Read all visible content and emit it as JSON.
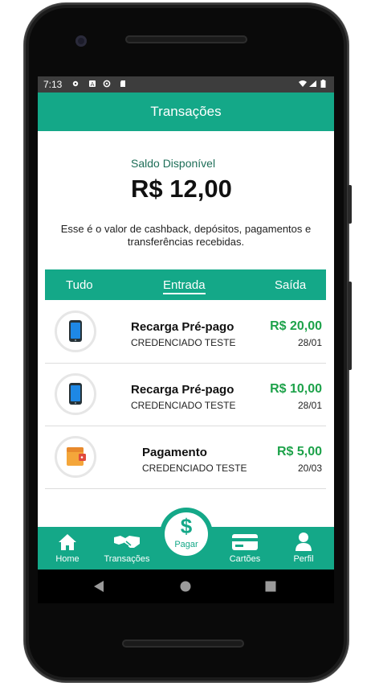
{
  "statusbar": {
    "time": "7:13"
  },
  "appbar": {
    "title": "Transações"
  },
  "balance": {
    "label": "Saldo Disponível",
    "value": "R$ 12,00",
    "description_line1": "Esse é o valor de cashback, depósitos, pagamentos e",
    "description_line2": "transferências recebidas."
  },
  "tabs": [
    {
      "label": "Tudo",
      "active": false
    },
    {
      "label": "Entrada",
      "active": true
    },
    {
      "label": "Saída",
      "active": false
    }
  ],
  "transactions": [
    {
      "title": "Recarga Pré-pago",
      "subtitle": "CREDENCIADO TESTE",
      "amount": "R$ 20,00",
      "date": "28/01",
      "icon": "phone-icon"
    },
    {
      "title": "Recarga Pré-pago",
      "subtitle": "CREDENCIADO TESTE",
      "amount": "R$ 10,00",
      "date": "28/01",
      "icon": "phone-icon"
    },
    {
      "title": "Pagamento",
      "subtitle": "CREDENCIADO TESTE",
      "amount": "R$ 5,00",
      "date": "20/03",
      "icon": "wallet-icon"
    }
  ],
  "bottom_nav": {
    "home": "Home",
    "transactions": "Transações",
    "pay": "Pagar",
    "pay_symbol": "$",
    "cards": "Cartões",
    "profile": "Perfil"
  },
  "colors": {
    "primary": "#14a888",
    "amount": "#1da24a",
    "statusbar": "#3d3d3d"
  }
}
